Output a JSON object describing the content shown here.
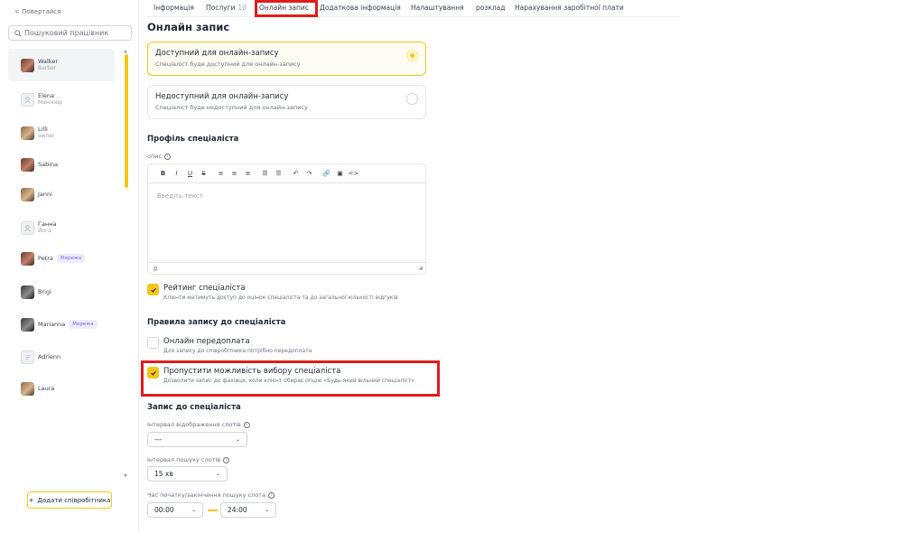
{
  "sidebar": {
    "back_label": "< Повертайся",
    "search_placeholder": "Пошуковий працівник",
    "employees": [
      {
        "name": "Walker",
        "role": "Barber"
      },
      {
        "name": "Elena",
        "role": "Манікюр"
      },
      {
        "name": "Lilli",
        "role": "owner"
      },
      {
        "name": "Sabina",
        "role": ""
      },
      {
        "name": "Janni",
        "role": ""
      },
      {
        "name": "Ганна",
        "role": "Йога"
      },
      {
        "name": "Petra",
        "role": "",
        "badge": "Мережа"
      },
      {
        "name": "Brigi",
        "role": ""
      },
      {
        "name": "Marianna",
        "role": "",
        "badge": "Мережа"
      },
      {
        "name": "Adrienn",
        "role": ""
      },
      {
        "name": "Laura",
        "role": ""
      }
    ],
    "add_button": "Додати співробітника"
  },
  "tabs": [
    {
      "label": "Інформація"
    },
    {
      "label": "Послуги",
      "count": "10"
    },
    {
      "label": "Онлайн запис"
    },
    {
      "label": "Додаткова інформація"
    },
    {
      "label": "Налаштування"
    },
    {
      "label": "розклад"
    },
    {
      "label": "Нарахування заробітної плати"
    }
  ],
  "page_title": "Онлайн запис",
  "availability": {
    "available": {
      "title": "Доступний для онлайн-запису",
      "subtitle": "Спеціаліст буде доступний для онлайн-запису",
      "selected": true
    },
    "unavailable": {
      "title": "Недоступний для онлайн-запису",
      "subtitle": "Спеціаліст буде недоступний для онлайн-запису",
      "selected": false
    }
  },
  "profile": {
    "section_title": "Профіль спеціаліста",
    "description_label": "опис",
    "editor_placeholder": "Введіть текст",
    "editor_footer": "p",
    "toolbar": [
      "B",
      "I",
      "U",
      "S",
      "≡",
      "≡",
      "≡",
      "☰",
      "☰",
      "↶",
      "↷",
      "🔗",
      "▣",
      "<>"
    ]
  },
  "rating": {
    "title": "Рейтинг спеціаліста",
    "subtitle": "Клієнти матимуть доступ до оцінок спеціаліста та до загальної кількості відгуків",
    "checked": true
  },
  "rules": {
    "section_title": "Правила запису до спеціаліста",
    "prepayment": {
      "title": "Онлайн передоплата",
      "subtitle": "Для запису до співробітника потрібно передоплата",
      "checked": false
    },
    "skip_choice": {
      "title": "Пропустити можливість вибору спеціаліста",
      "subtitle": "Дозволити запис до фахівця, коли клієнт обирає опцію «Будь-який вільний спеціаліст»",
      "checked": true
    }
  },
  "booking": {
    "section_title": "Запис до спеціаліста",
    "display_interval_label": "Інтервал відображення слотів",
    "display_interval_value": "---",
    "search_interval_label": "Інтервал пошуку слотів",
    "search_interval_value": "15 хв",
    "time_label": "Час початку/закінчення пошуку слота",
    "start_time": "00:00",
    "end_time": "24:00"
  }
}
